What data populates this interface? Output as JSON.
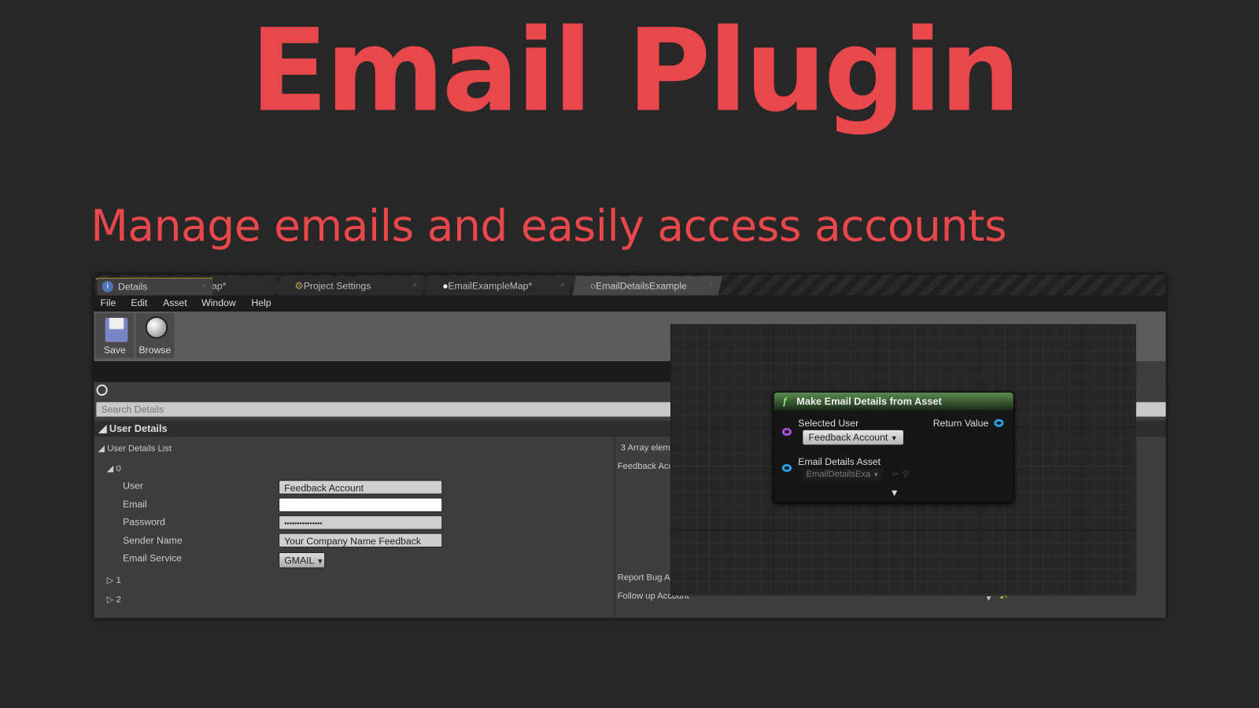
{
  "hero": {
    "title": "Email Plugin",
    "subtitle": "Manage emails and easily access accounts",
    "accent": "#e8474b"
  },
  "editor": {
    "tabs": [
      {
        "label": "EmailExampleMap*",
        "icon": "unreal-logo"
      },
      {
        "label": "Project Settings",
        "icon": "settings-icon"
      },
      {
        "label": "EmailExampleMap*",
        "icon": "sphere-icon"
      },
      {
        "label": "EmailDetailsExample",
        "icon": "circle-icon",
        "active": true
      }
    ],
    "menu": [
      "File",
      "Edit",
      "Asset",
      "Window",
      "Help"
    ],
    "toolbar": {
      "save": "Save",
      "browse": "Browse"
    },
    "details_tab": "Details",
    "search_placeholder": "Search Details",
    "category": "User Details",
    "list_label": "User Details List",
    "array_summary": "3 Array elem",
    "elements": [
      {
        "index": "0",
        "summary": "Feedback Acc"
      },
      {
        "index": "1",
        "summary": "Report Bug Ac"
      },
      {
        "index": "2",
        "summary": "Follow up Account"
      }
    ],
    "fields": {
      "user": {
        "label": "User",
        "value": "Feedback Account"
      },
      "email": {
        "label": "Email",
        "value": ""
      },
      "password": {
        "label": "Password",
        "value": "•••••••••••••••"
      },
      "sender": {
        "label": "Sender Name",
        "value": "Your Company Name Feedback"
      },
      "service": {
        "label": "Email Service",
        "value": "GMAIL"
      }
    },
    "node": {
      "title": "Make Email Details from Asset",
      "selected_user_label": "Selected User",
      "selected_user_value": "Feedback Account",
      "return_label": "Return Value",
      "asset_label": "Email Details Asset",
      "asset_value": "EmailDetailsExa"
    }
  }
}
